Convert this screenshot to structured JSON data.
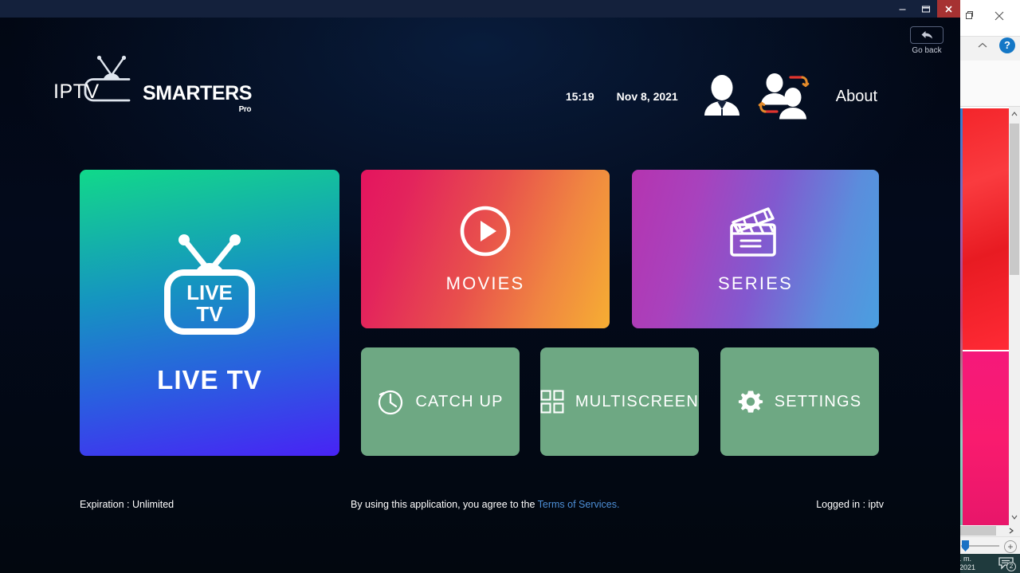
{
  "app": {
    "logo": {
      "iptv": "IPTV",
      "smarters": "SMARTERS",
      "pro": "Pro",
      "tv_icon": "tv-antenna-icon"
    },
    "window_controls": {
      "minimize": "minimize-icon",
      "restore": "restore-icon",
      "close": "close-icon"
    },
    "go_back": {
      "label": "Go back",
      "icon": "back-arrow-icon"
    }
  },
  "topbar": {
    "time": "15:19",
    "date": "Nov 8, 2021",
    "user_icon": "user-profile-icon",
    "switch_user_icon": "switch-user-icon",
    "about": "About"
  },
  "tiles": {
    "live_tv": {
      "label": "LIVE TV",
      "icon": "live-tv-icon",
      "icon_text_line1": "LIVE",
      "icon_text_line2": "TV"
    },
    "movies": {
      "label": "MOVIES",
      "icon": "play-circle-icon"
    },
    "series": {
      "label": "SERIES",
      "icon": "clapperboard-icon"
    },
    "catch_up": {
      "label": "CATCH UP",
      "icon": "clock-icon"
    },
    "multiscreen": {
      "label": "MULTISCREEN",
      "icon": "grid-icon"
    },
    "settings": {
      "label": "SETTINGS",
      "icon": "gear-icon"
    }
  },
  "footer": {
    "expiration": "Expiration : Unlimited",
    "terms_prefix": "By using this application, you agree to the ",
    "terms_link": "Terms of Services.",
    "logged_in": "Logged in : iptv"
  },
  "background_window": {
    "restore_icon": "restore-icon",
    "close_icon": "close-icon",
    "collapse_icon": "chevron-up-icon",
    "help_label": "?",
    "zoom_plus": "+"
  },
  "taskbar": {
    "clock_line1": ". m.",
    "clock_line2": "2021",
    "notification_icon": "notification-icon",
    "notification_count": "2"
  },
  "colors": {
    "accent_green": "#6ea883",
    "link_blue": "#4d8fd6",
    "close_red": "#a63232",
    "help_blue": "#1477c6",
    "background_navy": "#020713"
  }
}
